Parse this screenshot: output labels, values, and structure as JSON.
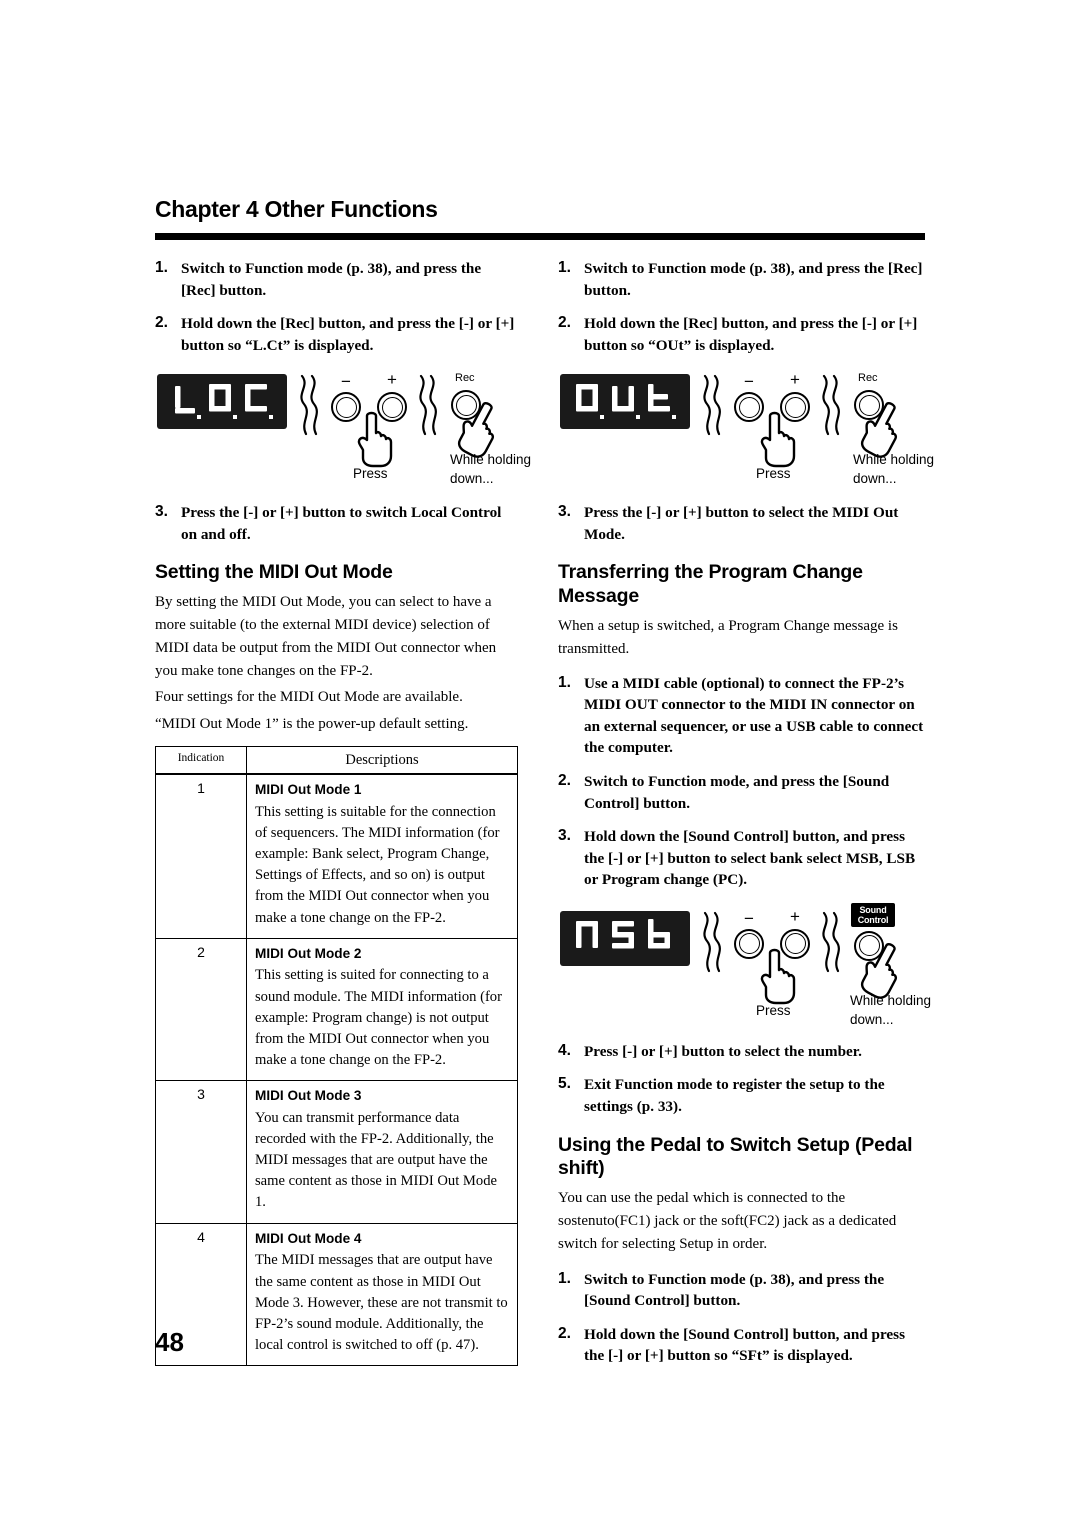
{
  "header": {
    "chapter_title": "Chapter 4 Other Functions"
  },
  "page_number": "48",
  "left_column": {
    "steps_top": [
      {
        "num": "1.",
        "text": "Switch to Function mode (p. 38), and press the [Rec] button."
      },
      {
        "num": "2.",
        "text": "Hold down the [Rec] button, and press the [-] or [+] button so “L.Ct” is displayed."
      }
    ],
    "diagram": {
      "led_text": "L.Ct",
      "minus_label": "−",
      "plus_label": "+",
      "button_label": "Rec",
      "press_caption": "Press",
      "hold_caption_line1": "While holding",
      "hold_caption_line2": "down..."
    },
    "step_after_diagram": {
      "num": "3.",
      "text": "Press the [-] or [+] button to switch Local Control on and off."
    },
    "section_heading": "Setting the MIDI Out Mode",
    "paragraphs": [
      "By setting the MIDI Out Mode, you can select to have a more suitable (to the external MIDI device) selection of MIDI data be output from the MIDI Out connector when you make tone changes on the FP-2.",
      "Four settings for the MIDI Out Mode are available.",
      "“MIDI Out Mode 1” is the power-up default setting."
    ],
    "table": {
      "headers": [
        "Indication",
        "Descriptions"
      ],
      "rows": [
        {
          "indication": "1",
          "mode_name": "MIDI Out Mode 1",
          "mode_body": "This setting is suitable for the connection of sequencers. The MIDI information (for example: Bank select, Program Change, Settings of Effects, and so on) is output from the MIDI Out connector when you make a tone change on the FP-2."
        },
        {
          "indication": "2",
          "mode_name": "MIDI Out Mode 2",
          "mode_body": "This setting is suited for connecting to a sound module. The MIDI information (for example: Program change) is not output from the MIDI Out connector when you make a tone change on the FP-2."
        },
        {
          "indication": "3",
          "mode_name": "MIDI Out Mode 3",
          "mode_body": "You can transmit performance data recorded with the FP-2.\nAdditionally, the MIDI messages that are output have the same content as those in MIDI Out Mode 1."
        },
        {
          "indication": "4",
          "mode_name": "MIDI Out Mode 4",
          "mode_body": "The MIDI messages that are output have the same content as those in MIDI Out Mode 3. However, these are not transmit to FP-2’s sound module.\nAdditionally, the local control is switched to off (p. 47)."
        }
      ]
    }
  },
  "right_column": {
    "steps_top": [
      {
        "num": "1.",
        "text": "Switch to Function mode (p. 38), and press the [Rec] button."
      },
      {
        "num": "2.",
        "text": "Hold down the [Rec] button, and press the [-] or [+] button so “OUt” is displayed."
      }
    ],
    "diagram_1": {
      "led_text": "OUt",
      "minus_label": "−",
      "plus_label": "+",
      "button_label": "Rec",
      "press_caption": "Press",
      "hold_caption_line1": "While holding",
      "hold_caption_line2": "down..."
    },
    "step_after_diagram": {
      "num": "3.",
      "text": "Press the [-] or [+] button to select the MIDI Out Mode."
    },
    "section_heading_1": "Transferring the Program Change Message",
    "paragraph_1": "When a setup is switched, a Program Change message is transmitted.",
    "steps_mid": [
      {
        "num": "1.",
        "text": "Use a MIDI cable (optional) to connect the FP-2’s MIDI OUT connector to the MIDI IN connector on an external sequencer, or use a USB cable to connect the computer."
      },
      {
        "num": "2.",
        "text": "Switch to Function mode, and press the [Sound Control] button."
      },
      {
        "num": "3.",
        "text": "Hold down the [Sound Control] button, and press the [-] or [+] button to select bank select MSB, LSB or Program change (PC)."
      }
    ],
    "diagram_2": {
      "led_text": "MSb",
      "minus_label": "−",
      "plus_label": "+",
      "badge_line1": "Sound",
      "badge_line2": "Control",
      "press_caption": "Press",
      "hold_caption_line1": "While holding",
      "hold_caption_line2": "down..."
    },
    "steps_after_diagram2": [
      {
        "num": "4.",
        "text": "Press [-] or [+] button to select the number."
      },
      {
        "num": "5.",
        "text": "Exit Function mode to register the setup to the settings (p. 33)."
      }
    ],
    "section_heading_2": "Using the Pedal to Switch Setup (Pedal shift)",
    "paragraph_2": "You can use the pedal which is connected to the sostenuto(FC1) jack or the soft(FC2) jack as a dedicated switch for selecting Setup in order.",
    "steps_bottom": [
      {
        "num": "1.",
        "text": "Switch to Function mode (p. 38), and press the [Sound Control] button."
      },
      {
        "num": "2.",
        "text": "Hold down the [Sound Control] button, and press the [-] or [+] button so “SFt” is displayed."
      }
    ]
  }
}
